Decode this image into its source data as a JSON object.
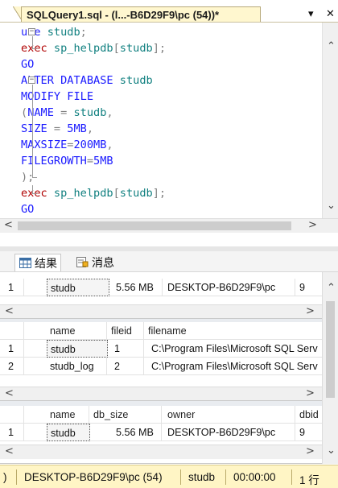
{
  "tab": {
    "title": "SQLQuery1.sql - (l...-B6D29F9\\pc (54))*",
    "dropdown": "▾",
    "close": "✕"
  },
  "editor": {
    "lines": [
      {
        "fold": "open",
        "parts": [
          [
            "kw",
            "use "
          ],
          [
            "ident",
            "studb"
          ],
          [
            "gray",
            ";"
          ]
        ]
      },
      {
        "fold": "end",
        "parts": [
          [
            "proc",
            "exec "
          ],
          [
            "ident",
            "sp_helpdb"
          ],
          [
            "gray",
            "["
          ],
          [
            "ident",
            "studb"
          ],
          [
            "gray",
            "];"
          ]
        ]
      },
      {
        "fold": "",
        "parts": [
          [
            "kw",
            "GO"
          ]
        ]
      },
      {
        "fold": "open",
        "parts": [
          [
            "kw",
            "ALTER DATABASE "
          ],
          [
            "ident",
            "studb"
          ]
        ]
      },
      {
        "fold": "mid",
        "parts": [
          [
            "kw",
            "MODIFY FILE"
          ]
        ]
      },
      {
        "fold": "mid",
        "parts": [
          [
            "gray",
            "("
          ],
          [
            "kw",
            "NAME "
          ],
          [
            "gray",
            "= "
          ],
          [
            "ident",
            "studb"
          ],
          [
            "gray",
            ","
          ]
        ]
      },
      {
        "fold": "mid",
        "parts": [
          [
            "kw",
            "SIZE "
          ],
          [
            "gray",
            "= "
          ],
          [
            "kw",
            "5MB"
          ],
          [
            "gray",
            ","
          ]
        ]
      },
      {
        "fold": "mid",
        "parts": [
          [
            "kw",
            "MAXSIZE"
          ],
          [
            "gray",
            "="
          ],
          [
            "kw",
            "200MB"
          ],
          [
            "gray",
            ","
          ]
        ]
      },
      {
        "fold": "mid",
        "parts": [
          [
            "kw",
            "FILEGROWTH"
          ],
          [
            "gray",
            "="
          ],
          [
            "kw",
            "5MB"
          ]
        ]
      },
      {
        "fold": "close",
        "parts": [
          [
            "gray",
            ");"
          ]
        ]
      },
      {
        "fold": "end",
        "parts": [
          [
            "proc",
            "exec "
          ],
          [
            "ident",
            "sp_helpdb"
          ],
          [
            "gray",
            "["
          ],
          [
            "ident",
            "studb"
          ],
          [
            "gray",
            "];"
          ]
        ]
      },
      {
        "fold": "",
        "parts": [
          [
            "kw",
            "GO"
          ]
        ]
      }
    ]
  },
  "result_tabs": {
    "results": "结果",
    "messages": "消息"
  },
  "grid1": {
    "rows": [
      {
        "num": "1",
        "cells": [
          "studb",
          "5.56 MB",
          "DESKTOP-B6D29F9\\pc",
          "9"
        ]
      }
    ]
  },
  "grid2": {
    "headers": [
      "name",
      "fileid",
      "filename"
    ],
    "rows": [
      {
        "num": "1",
        "cells": [
          "studb",
          "1",
          "C:\\Program Files\\Microsoft SQL Serv"
        ]
      },
      {
        "num": "2",
        "cells": [
          "studb_log",
          "2",
          "C:\\Program Files\\Microsoft SQL Serv"
        ]
      }
    ]
  },
  "grid3": {
    "headers": [
      "name",
      "db_size",
      "owner",
      "dbid"
    ],
    "rows": [
      {
        "num": "1",
        "cells": [
          "studb",
          "5.56 MB",
          "DESKTOP-B6D29F9\\pc",
          "9"
        ]
      }
    ]
  },
  "status": {
    "lead": ")",
    "server": "DESKTOP-B6D29F9\\pc (54)",
    "database": "studb",
    "elapsed": "00:00:00",
    "rows": "1 行"
  },
  "colors": {
    "keyword": "#1a1aff",
    "identifier": "#0f7f7f",
    "procedure": "#b00000",
    "status_bg": "#fff5c5",
    "tab_bg": "#fff7cf"
  }
}
